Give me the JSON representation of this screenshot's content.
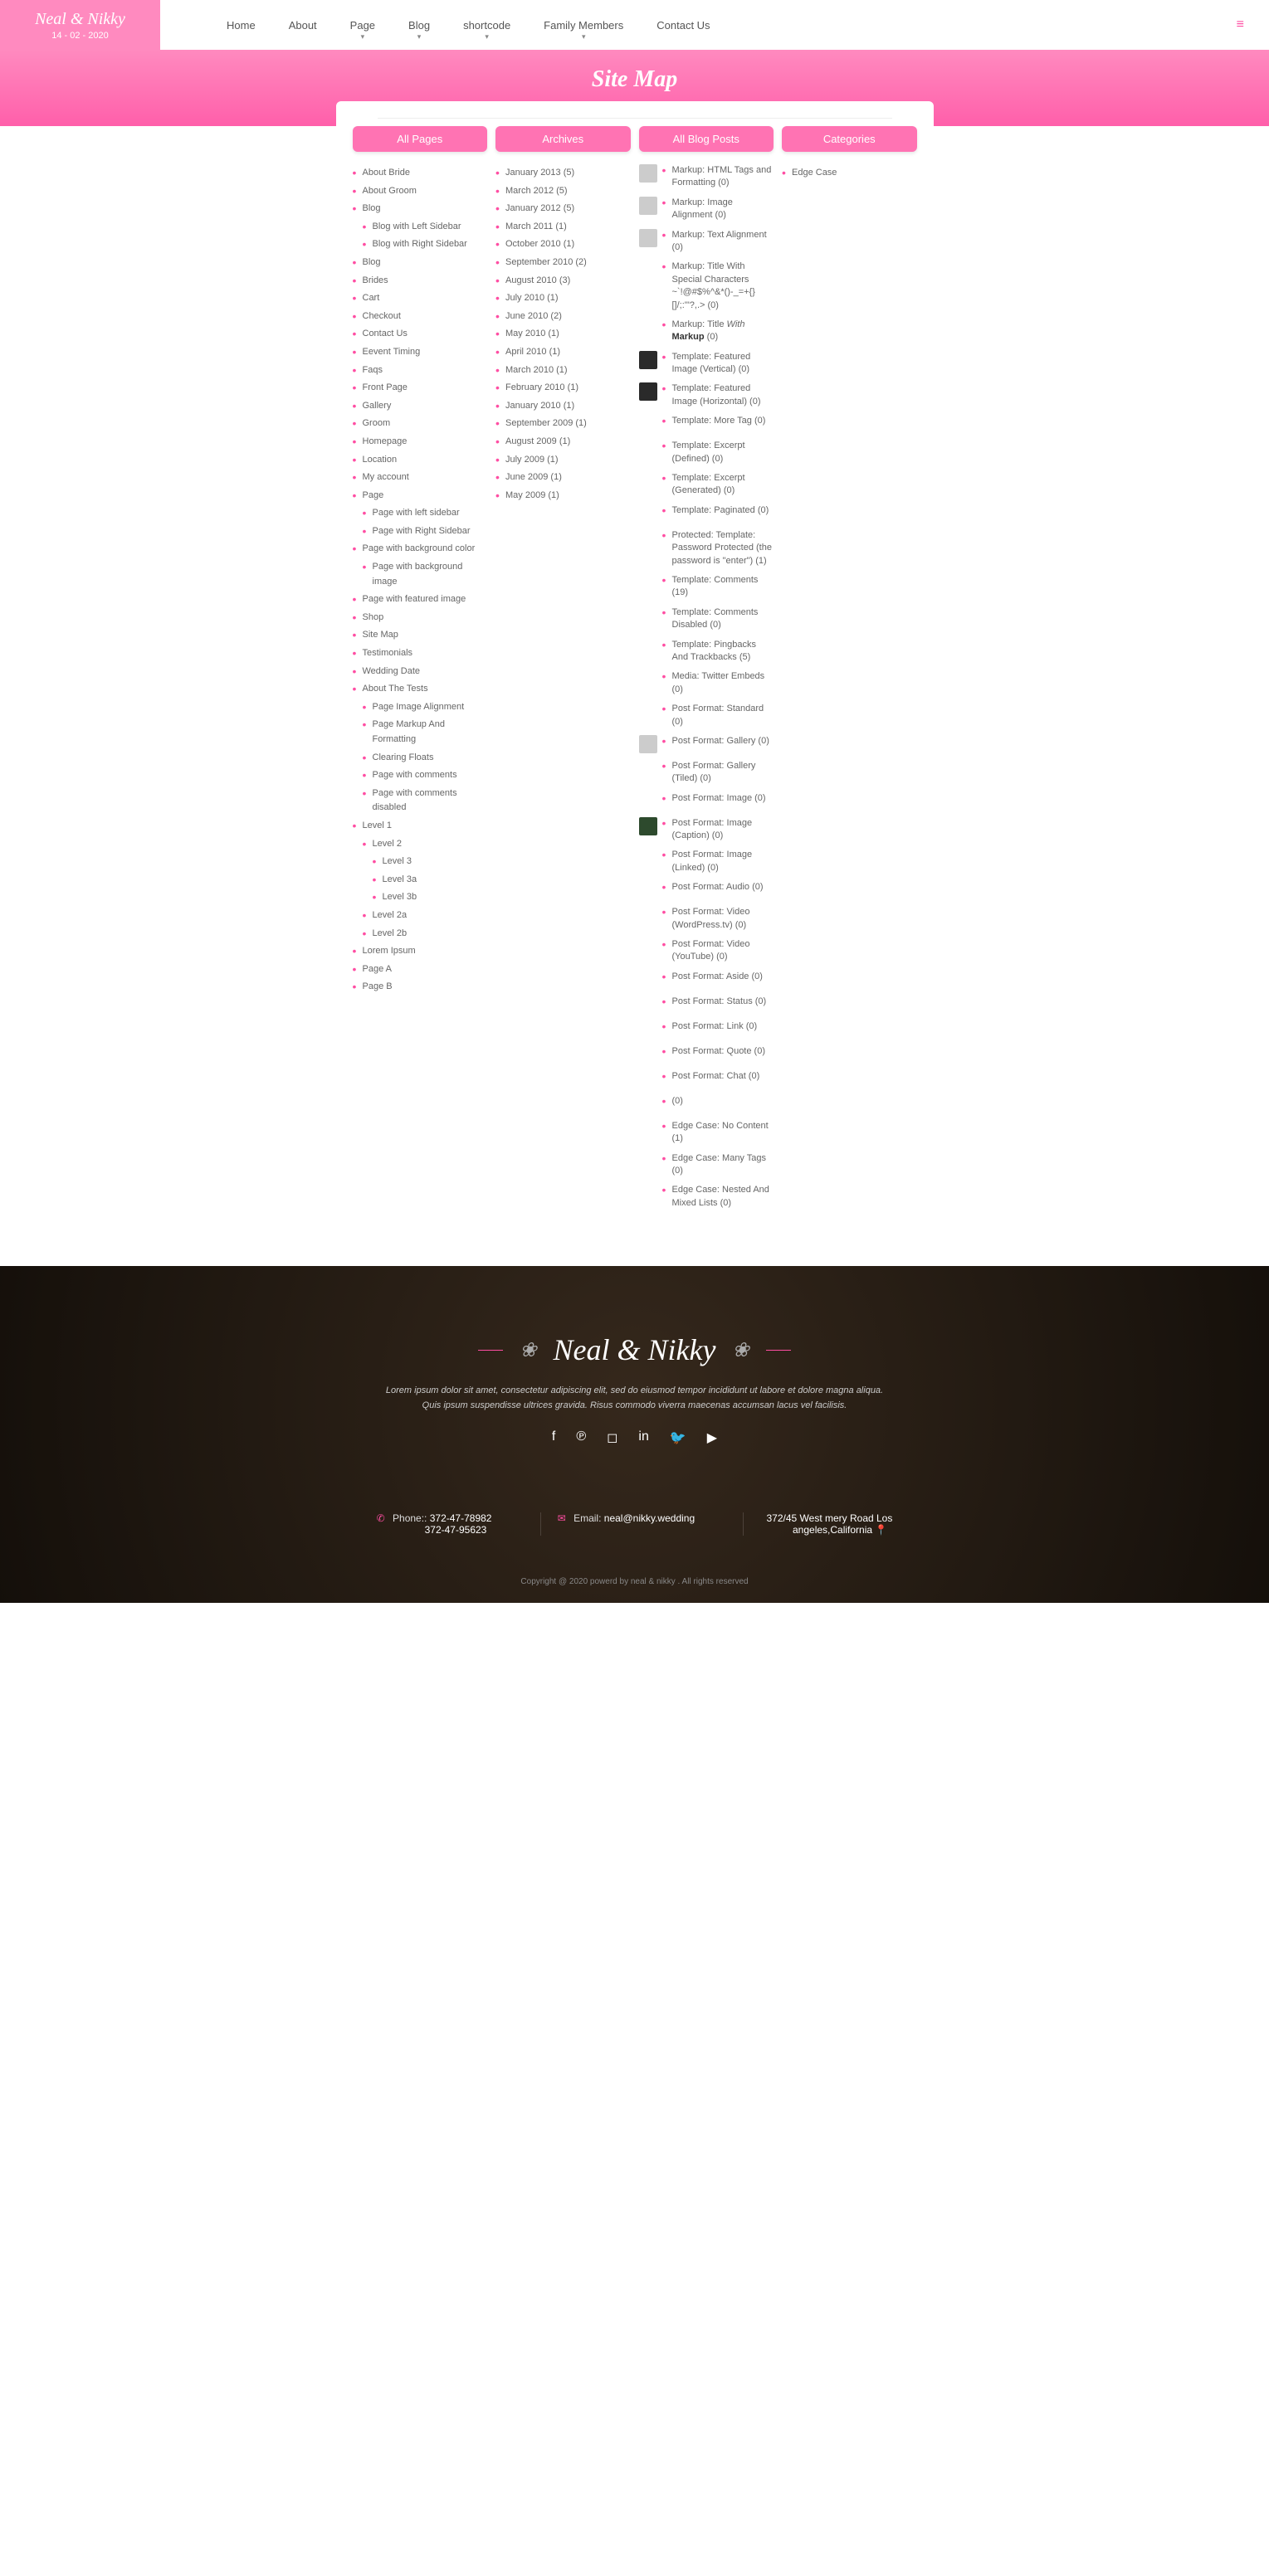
{
  "site": {
    "name": "Neal & Nikky",
    "date": "14 - 02 - 2020"
  },
  "nav": [
    "Home",
    "About",
    "Page",
    "Blog",
    "shortcode",
    "Family Members",
    "Contact Us"
  ],
  "navDropdown": [
    false,
    false,
    true,
    true,
    true,
    true,
    false
  ],
  "hero": {
    "title": "Site Map"
  },
  "cols": {
    "pages": "All Pages",
    "archives": "Archives",
    "blog": "All Blog Posts",
    "cats": "Categories"
  },
  "pages": [
    {
      "t": "About Bride"
    },
    {
      "t": "About Groom"
    },
    {
      "t": "Blog",
      "c": [
        {
          "t": "Blog with Left Sidebar"
        },
        {
          "t": "Blog with Right Sidebar"
        }
      ]
    },
    {
      "t": "Blog"
    },
    {
      "t": "Brides"
    },
    {
      "t": "Cart"
    },
    {
      "t": "Checkout"
    },
    {
      "t": "Contact Us"
    },
    {
      "t": "Eevent Timing"
    },
    {
      "t": "Faqs"
    },
    {
      "t": "Front Page"
    },
    {
      "t": "Gallery"
    },
    {
      "t": "Groom"
    },
    {
      "t": "Homepage"
    },
    {
      "t": "Location"
    },
    {
      "t": "My account"
    },
    {
      "t": "Page",
      "c": [
        {
          "t": "Page with left sidebar"
        },
        {
          "t": "Page with Right Sidebar"
        }
      ]
    },
    {
      "t": "Page with background color",
      "c": [
        {
          "t": "Page with background image"
        }
      ]
    },
    {
      "t": "Page with featured image"
    },
    {
      "t": "Shop"
    },
    {
      "t": "Site Map"
    },
    {
      "t": "Testimonials"
    },
    {
      "t": "Wedding Date"
    },
    {
      "t": "About The Tests",
      "c": [
        {
          "t": "Page Image Alignment"
        },
        {
          "t": "Page Markup And Formatting"
        },
        {
          "t": "Clearing Floats"
        },
        {
          "t": "Page with comments"
        },
        {
          "t": "Page with comments disabled"
        }
      ]
    },
    {
      "t": "Level 1",
      "c": [
        {
          "t": "Level 2",
          "c": [
            {
              "t": "Level 3"
            },
            {
              "t": "Level 3a"
            },
            {
              "t": "Level 3b"
            }
          ]
        },
        {
          "t": "Level 2a"
        },
        {
          "t": "Level 2b"
        }
      ]
    },
    {
      "t": "Lorem Ipsum"
    },
    {
      "t": "Page A"
    },
    {
      "t": "Page B"
    }
  ],
  "archives": [
    "January 2013 (5)",
    "March 2012 (5)",
    "January 2012 (5)",
    "March 2011 (1)",
    "October 2010 (1)",
    "September 2010 (2)",
    "August 2010 (3)",
    "July 2010 (1)",
    "June 2010 (2)",
    "May 2010 (1)",
    "April 2010 (1)",
    "March 2010 (1)",
    "February 2010 (1)",
    "January 2010 (1)",
    "September 2009 (1)",
    "August 2009 (1)",
    "July 2009 (1)",
    "June 2009 (1)",
    "May 2009 (1)"
  ],
  "blogposts": [
    {
      "thumb": "img",
      "html": "Markup: HTML Tags and Formatting (0)"
    },
    {
      "thumb": "img",
      "html": "Markup: Image Alignment (0)"
    },
    {
      "thumb": "img",
      "html": "Markup: Text Alignment (0)"
    },
    {
      "thumb": "none",
      "html": "Markup: Title With Special Characters ~`!@#$%^&*()-_=+{}[]/;:'\"?,.> (0)"
    },
    {
      "thumb": "none",
      "html": "Markup: Title <em>With</em> <strong>Markup</strong> (0)"
    },
    {
      "thumb": "dark",
      "html": "Template: Featured Image (Vertical) (0)"
    },
    {
      "thumb": "dark",
      "html": "Template: Featured Image (Horizontal) (0)"
    },
    {
      "thumb": "none",
      "html": "Template: More Tag (0)"
    },
    {
      "thumb": "none",
      "html": "Template: Excerpt (Defined) (0)"
    },
    {
      "thumb": "none",
      "html": "Template: Excerpt (Generated) (0)"
    },
    {
      "thumb": "none",
      "html": "Template: Paginated (0)"
    },
    {
      "thumb": "none",
      "html": "Protected: Template: Password Protected (the password is \"enter\") (1)"
    },
    {
      "thumb": "none",
      "html": "Template: Comments (19)"
    },
    {
      "thumb": "none",
      "html": "Template: Comments Disabled (0)"
    },
    {
      "thumb": "none",
      "html": "Template: Pingbacks And Trackbacks (5)"
    },
    {
      "thumb": "none",
      "html": "Media: Twitter Embeds (0)"
    },
    {
      "thumb": "none",
      "html": "Post Format: Standard (0)"
    },
    {
      "thumb": "img",
      "html": "Post Format: Gallery (0)"
    },
    {
      "thumb": "none",
      "html": "Post Format: Gallery (Tiled) (0)"
    },
    {
      "thumb": "none",
      "html": "Post Format: Image (0)"
    },
    {
      "thumb": "green",
      "html": "Post Format: Image (Caption) (0)"
    },
    {
      "thumb": "none",
      "html": "Post Format: Image (Linked) (0)"
    },
    {
      "thumb": "none",
      "html": "Post Format: Audio (0)"
    },
    {
      "thumb": "none",
      "html": "Post Format: Video (WordPress.tv) (0)"
    },
    {
      "thumb": "none",
      "html": "Post Format: Video (YouTube) (0)"
    },
    {
      "thumb": "none",
      "html": "Post Format: Aside (0)"
    },
    {
      "thumb": "none",
      "html": "Post Format: Status (0)"
    },
    {
      "thumb": "none",
      "html": "Post Format: Link (0)"
    },
    {
      "thumb": "none",
      "html": "Post Format: Quote (0)"
    },
    {
      "thumb": "none",
      "html": "Post Format: Chat (0)"
    },
    {
      "thumb": "none",
      "html": " (0)"
    },
    {
      "thumb": "none",
      "html": "Edge Case: No Content (1)"
    },
    {
      "thumb": "none",
      "html": "Edge Case: Many Tags (0)"
    },
    {
      "thumb": "none",
      "html": "Edge Case: Nested And Mixed Lists (0)"
    }
  ],
  "categories": [
    "Edge Case"
  ],
  "footer": {
    "title": "Neal & Nikky",
    "desc": "Lorem ipsum dolor sit amet, consectetur adipiscing elit, sed do eiusmod tempor incididunt ut labore et dolore magna aliqua. Quis ipsum suspendisse ultrices gravida. Risus commodo viverra maecenas accumsan lacus vel facilisis.",
    "phoneLabel": "Phone::",
    "phone1": "372-47-78982",
    "phone2": "372-47-95623",
    "emailLabel": "Email:",
    "email": "neal@nikky.wedding",
    "address": "372/45 West mery Road Los angeles,California",
    "copyright": "Copyright @ 2020 powerd by neal & nikky . All rights reserved"
  }
}
